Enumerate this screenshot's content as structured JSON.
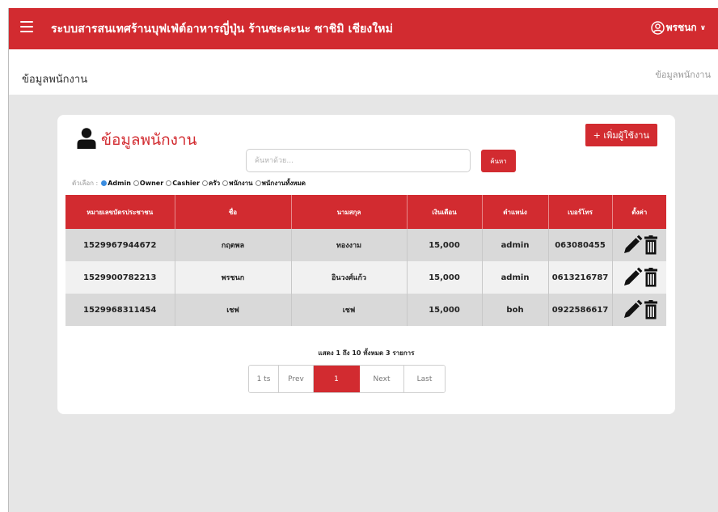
{
  "header": {
    "title": "ระบบสารสนเทศร้านบุฟเฟ่ต์อาหารญี่ปุ่น ร้านซะคะนะ ซาชิมิ เชียงใหม่",
    "user_name": "พรชนก",
    "caret": "∨"
  },
  "subheader": {
    "page_title": "ข้อมูลพนักงาน",
    "breadcrumb": "ข้อมูลพนักงาน"
  },
  "card": {
    "title": "ข้อมูลพนักงาน",
    "add_button": "+ เพิ่มผู้ใช้งาน",
    "search_placeholder": "ค้นหาด้วย...",
    "search_value": "",
    "search_button": "ค้นหา",
    "filter_label": "ตัวเลือก :",
    "filter_options": [
      "Admin",
      "Owner",
      "Cashier",
      "ครัว",
      "พนักงาน",
      "พนักงานทั้งหมด"
    ],
    "selected_filter": "Admin"
  },
  "table": {
    "columns": [
      "หมายเลขบัตรประชาชน",
      "ชื่อ",
      "นามสกุล",
      "เงินเดือน",
      "ตำแหน่ง",
      "เบอร์โทร",
      "ตั้งค่า"
    ],
    "rows": [
      [
        "1529967944672",
        "กฤตพล",
        "ทองงาม",
        "15,000",
        "admin",
        "063080455"
      ],
      [
        "1529900782213",
        "พรชนก",
        "อินวงศ์แก้ว",
        "15,000",
        "admin",
        "0613216787"
      ],
      [
        "1529968311454",
        "เชฟ",
        "เชฟ",
        "15,000",
        "boh",
        "0922586617"
      ]
    ]
  },
  "pagination": {
    "info": "แสดง 1 ถึง 10 ทั้งหมด 3 รายการ",
    "first": "1 ts",
    "prev": "Prev",
    "current": "1",
    "next": "Next",
    "last": "Last"
  },
  "colors": {
    "accent": "#d22b30",
    "background": "#e6e6e6",
    "radio_selected": "#3a8de0"
  },
  "icons": {
    "menu": "hamburger-icon",
    "user": "user-circle-icon",
    "person": "person-icon",
    "edit": "pencil-icon",
    "delete": "trash-icon"
  }
}
